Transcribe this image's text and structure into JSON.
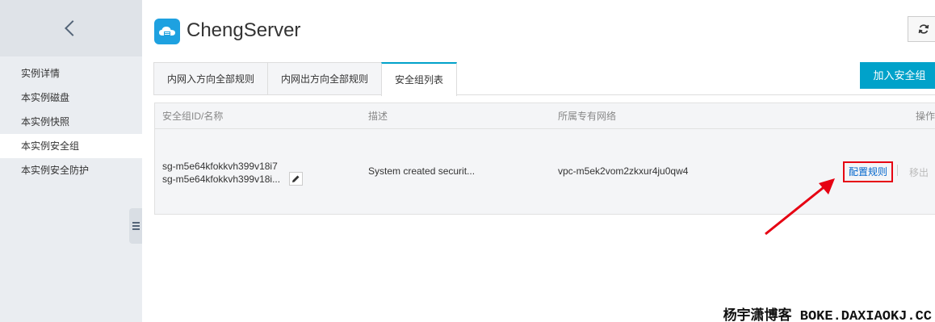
{
  "sidebar": {
    "items": [
      {
        "label": "实例详情"
      },
      {
        "label": "本实例磁盘"
      },
      {
        "label": "本实例快照"
      },
      {
        "label": "本实例安全组"
      },
      {
        "label": "本实例安全防护"
      }
    ],
    "active_item": "本实例安全组"
  },
  "header": {
    "title": "ChengServer"
  },
  "tabs": [
    {
      "label": "内网入方向全部规则"
    },
    {
      "label": "内网出方向全部规则"
    },
    {
      "label": "安全组列表"
    }
  ],
  "active_tab": "安全组列表",
  "actions": {
    "add_label": "加入安全组"
  },
  "table": {
    "columns": [
      "安全组ID/名称",
      "描述",
      "所属专有网络",
      "操作"
    ],
    "rows": [
      {
        "id": "sg-m5e64kfokkvh399v18i7",
        "name": "sg-m5e64kfokkvh399v18i...",
        "description": "System created securit...",
        "vpc": "vpc-m5ek2vom2zkxur4ju0qw4",
        "action_config": "配置规则",
        "action_remove": "移出"
      }
    ]
  },
  "colors": {
    "accent": "#00a2ca",
    "highlight_box": "#e60012",
    "link": "#0066cc"
  },
  "watermark": "杨宇潇博客 BOKE.DAXIAOKJ.CC"
}
